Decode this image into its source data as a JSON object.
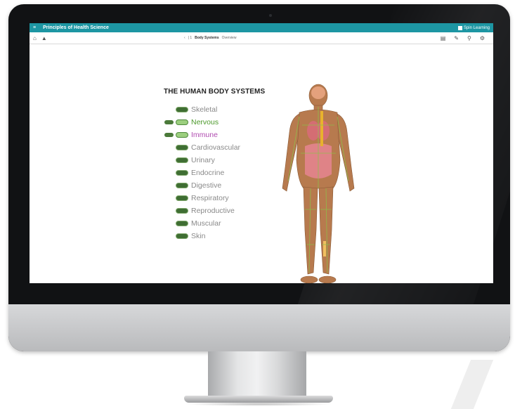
{
  "window": {
    "menu_icon": "menu-icon",
    "title": "Principles of Health Science",
    "brand": "Spin Learning",
    "brand_icon": "book-icon",
    "accent_color": "#1d96a3"
  },
  "toolbar": {
    "left_icons": [
      "home-icon",
      "bookmark-icon"
    ],
    "breadcrumb_icon": "chevron-back-icon",
    "breadcrumb_sep": "| 1",
    "breadcrumb_current": "Body Systems",
    "breadcrumb_sub": "Overview",
    "right_icons": [
      "notebook-icon",
      "edit-icon",
      "zoom-icon",
      "settings-icon"
    ]
  },
  "main": {
    "heading": "THE HUMAN BODY SYSTEMS",
    "systems": [
      {
        "label": "Skeletal",
        "chip": "Go",
        "extra_chip": false,
        "color": "#8a8a8a"
      },
      {
        "label": "Nervous",
        "chip": "Go",
        "extra_chip": true,
        "color": "#4d9a2c"
      },
      {
        "label": "Immune",
        "chip": "Go",
        "extra_chip": true,
        "color": "#b04bb0"
      },
      {
        "label": "Cardiovascular",
        "chip": "Go",
        "extra_chip": false,
        "color": "#8a8a8a"
      },
      {
        "label": "Urinary",
        "chip": "Go",
        "extra_chip": false,
        "color": "#8a8a8a"
      },
      {
        "label": "Endocrine",
        "chip": "Go",
        "extra_chip": false,
        "color": "#8a8a8a"
      },
      {
        "label": "Digestive",
        "chip": "Go",
        "extra_chip": false,
        "color": "#8a8a8a"
      },
      {
        "label": "Respiratory",
        "chip": "Go",
        "extra_chip": false,
        "color": "#8a8a8a"
      },
      {
        "label": "Reproductive",
        "chip": "Go",
        "extra_chip": false,
        "color": "#8a8a8a"
      },
      {
        "label": "Muscular",
        "chip": "Go",
        "extra_chip": false,
        "color": "#8a8a8a"
      },
      {
        "label": "Skin",
        "chip": "Go",
        "extra_chip": false,
        "color": "#8a8a8a"
      }
    ],
    "figure": "human-body-illustration"
  }
}
